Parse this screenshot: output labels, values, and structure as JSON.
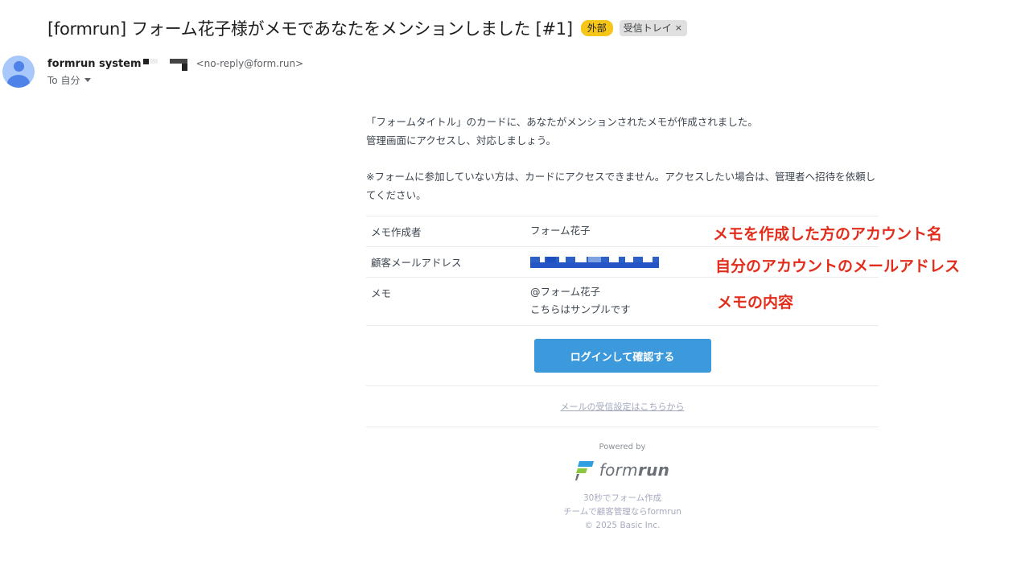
{
  "subject": {
    "title": "[formrun] フォーム花子様がメモであなたをメンションしました [#1]",
    "badge_external": "外部",
    "badge_inbox": "受信トレイ",
    "badge_close": "×"
  },
  "sender": {
    "name": "formrun system",
    "email": "<no-reply@form.run>",
    "recipient": "To 自分"
  },
  "body": {
    "line1": "「フォームタイトル」のカードに、あなたがメンションされたメモが作成されました。",
    "line2": "管理画面にアクセスし、対応しましょう。",
    "note": "※フォームに参加していない方は、カードにアクセスできません。アクセスしたい場合は、管理者へ招待を依頼してください。",
    "table": [
      {
        "label": "メモ作成者",
        "value": "フォーム花子"
      },
      {
        "label": "顧客メールアドレス",
        "value": ""
      },
      {
        "label": "メモ",
        "value_line1": "@フォーム花子",
        "value_line2": "こちらはサンプルです"
      }
    ],
    "button": "ログインして確認する",
    "settings_link": "メールの受信設定はこちらから"
  },
  "footer": {
    "powered_by": "Powered by",
    "logo_form": "form",
    "logo_run": "run",
    "tagline1": "30秒でフォーム作成",
    "tagline2": "チームで顧客管理ならformrun",
    "copyright": "© 2025 Basic Inc."
  },
  "annotations": {
    "a1": "メモを作成した方のアカウント名",
    "a2": "自分のアカウントのメールアドレス",
    "a3": "メモの内容"
  },
  "colors": {
    "badge_external": "#f5c518",
    "button": "#3b99dc",
    "annotation": "#e22d1c",
    "avatar": "#a8c7fa"
  },
  "icons": {
    "avatar": "person-avatar-icon",
    "recipient_caret": "caret-down-icon",
    "logo": "formrun-logo-icon"
  }
}
